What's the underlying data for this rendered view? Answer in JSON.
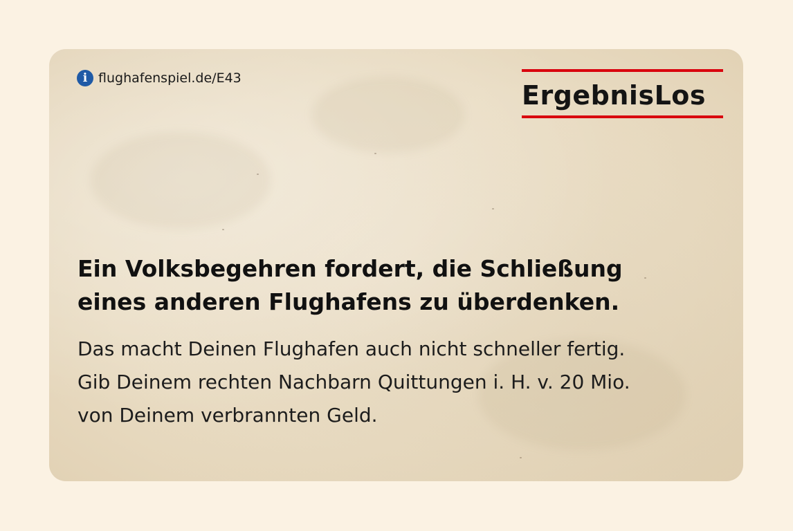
{
  "card": {
    "info_icon": "info-icon",
    "info_glyph": "i",
    "link_text": "flughafenspiel.de/E43",
    "brand": "ErgebnisLos",
    "headline_lines": [
      "Ein Volksbegehren fordert, die Schließung",
      "eines anderen Flughafens zu überdenken."
    ],
    "body_lines": [
      "Das macht Deinen Flughafen auch nicht schneller fertig.",
      "Gib Deinem rechten Nachbarn Quittungen i. H. v. 20 Mio.",
      "von Deinem verbrannten Geld."
    ]
  },
  "colors": {
    "page_background": "#fbf2e3",
    "card_paper": "#e9dcc3",
    "brand_red": "#d9000d",
    "info_blue": "#1f5aa6",
    "text": "#111111"
  }
}
